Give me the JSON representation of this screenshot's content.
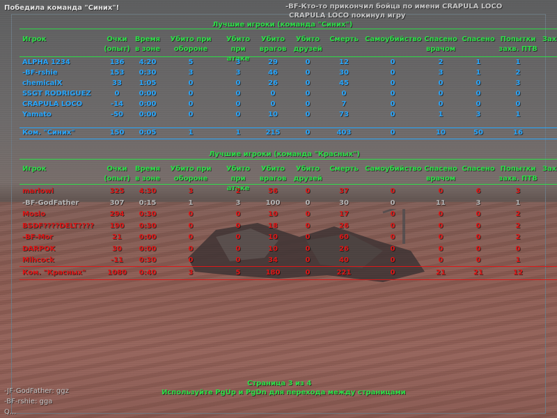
{
  "hud": {
    "announce": "Победила команда \"Синих\"!",
    "kill_msg": "-BF-Кто-то прикончил бойца по имени CRAPULA LOCO",
    "left_msg": "CRAPULA LOCO покинул игру",
    "footer_chat": [
      "-JF-GodFather: ggz",
      "-BF-rshie: gga"
    ],
    "bottom_partial": "Q..."
  },
  "columns": [
    "Игрок",
    "Очки (опыт)",
    "Время в зоне",
    "Убито при обороне",
    "Убито при атаке",
    "Убито врагов",
    "Убито друзей",
    "Смерть",
    "Самоубийство",
    "Спасено врачом",
    "Спасено",
    "Попытки захв. ПТВ",
    "Зах"
  ],
  "blue_team": {
    "title": "Лучшие игроки (команда \"Синих\")",
    "rows": [
      [
        "ALPHA 1234",
        "136",
        "4:20",
        "5",
        "3",
        "29",
        "0",
        "12",
        "0",
        "2",
        "1",
        "1"
      ],
      [
        "-BF-rshie",
        "153",
        "0:30",
        "3",
        "3",
        "46",
        "0",
        "30",
        "0",
        "3",
        "1",
        "2"
      ],
      [
        "chemicalX",
        "33",
        "1:05",
        "0",
        "0",
        "26",
        "0",
        "45",
        "0",
        "0",
        "0",
        "3"
      ],
      [
        "SSGT RODRIGUEZ",
        "0",
        "0:00",
        "0",
        "0",
        "0",
        "0",
        "0",
        "0",
        "0",
        "0",
        "0"
      ],
      [
        "CRAPULA LOCO",
        "-14",
        "0:00",
        "0",
        "0",
        "0",
        "0",
        "7",
        "0",
        "0",
        "0",
        "0"
      ],
      [
        "Yamato",
        "-50",
        "0:00",
        "0",
        "0",
        "10",
        "0",
        "73",
        "0",
        "1",
        "3",
        "1"
      ]
    ],
    "total": [
      "Ком. \"Синих\"",
      "150",
      "0:05",
      "1",
      "1",
      "215",
      "0",
      "403",
      "0",
      "10",
      "50",
      "16"
    ]
  },
  "red_team": {
    "title": "Лучшие игроки (команда \"Красных\")",
    "rows": [
      [
        "marlowi",
        "325",
        "4:30",
        "3",
        "2",
        "56",
        "0",
        "37",
        "0",
        "0",
        "6",
        "3"
      ],
      [
        "-BF-GodFather",
        "307",
        "0:15",
        "1",
        "3",
        "100",
        "0",
        "30",
        "0",
        "11",
        "3",
        "1"
      ],
      [
        "Moslo",
        "294",
        "0:30",
        "0",
        "0",
        "10",
        "0",
        "17",
        "0",
        "0",
        "0",
        "2"
      ],
      [
        "BSDF????DELT????",
        "190",
        "0:30",
        "0",
        "0",
        "18",
        "0",
        "26",
        "0",
        "0",
        "0",
        "2"
      ],
      [
        "-BF-Mor",
        "21",
        "0:00",
        "0",
        "0",
        "10",
        "0",
        "60",
        "0",
        "0",
        "0",
        "2"
      ],
      [
        "DARPOK",
        "30",
        "0:00",
        "0",
        "0",
        "10",
        "0",
        "26",
        "0",
        "0",
        "0",
        "0"
      ],
      [
        "Mihcock",
        "-11",
        "0:30",
        "0",
        "0",
        "34",
        "0",
        "40",
        "0",
        "0",
        "0",
        "1"
      ]
    ],
    "total": [
      "Ком. \"Красных\"",
      "1080",
      "0:40",
      "3",
      "5",
      "180",
      "0",
      "221",
      "0",
      "21",
      "21",
      "12"
    ]
  },
  "footer": {
    "page": "Страница 3 из 4",
    "hint": "Используйте PgUp и PgDn для перехода между страницами"
  },
  "colors": {
    "green": "#2fe04a",
    "blue": "#2aa8ff",
    "red": "#e01818",
    "frame": "#6f7c86"
  }
}
